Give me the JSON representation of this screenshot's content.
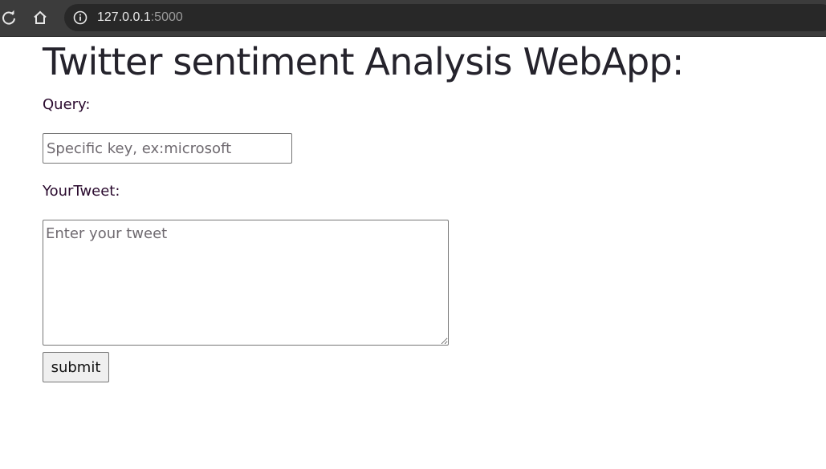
{
  "browser": {
    "url_host": "127.0.0.1",
    "url_port": ":5000",
    "icons": {
      "reload": "reload-icon",
      "home": "home-icon",
      "info": "info-icon"
    }
  },
  "page": {
    "title": "Twitter sentiment Analysis WebApp:",
    "query_label": "Query:",
    "query_placeholder": "Specific key, ex:microsoft",
    "query_value": "",
    "tweet_label": "YourTweet:",
    "tweet_placeholder": "Enter your tweet",
    "tweet_value": "",
    "submit_label": "submit"
  },
  "colors": {
    "browser_bar": "#3c3c3c",
    "omnibox": "#282828",
    "url_text": "#e8e8e8",
    "url_port": "#9b9b9b",
    "label_text": "#2a0a2e",
    "title_text": "#25232c"
  }
}
